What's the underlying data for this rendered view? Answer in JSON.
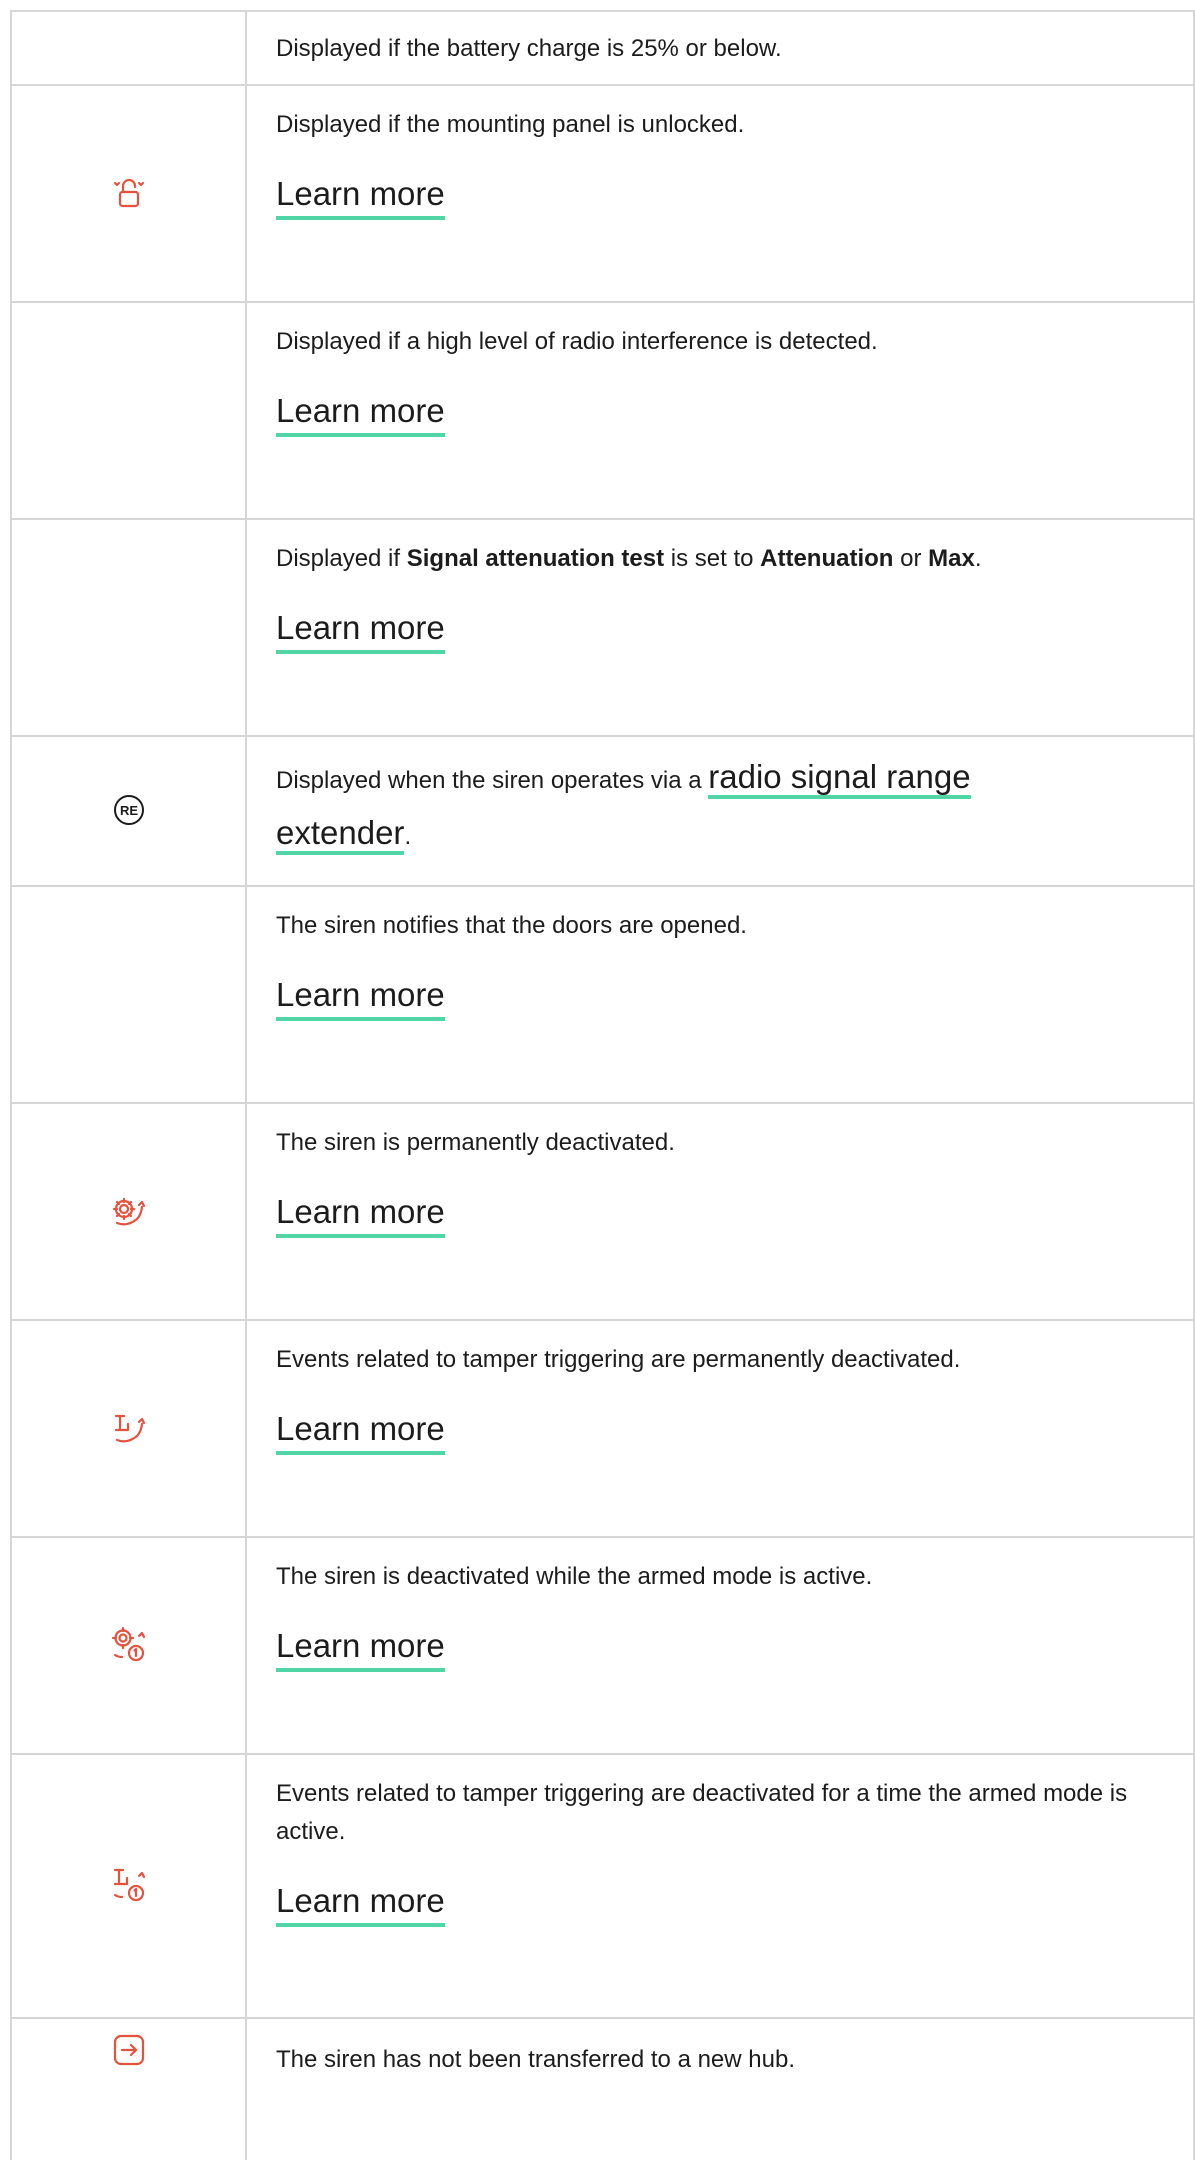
{
  "colors": {
    "icon_red": "#e5523d",
    "link_underline": "#4fd6a4",
    "grid": "#d6d6d6",
    "text": "#1c1c1c"
  },
  "learn_more": "Learn more",
  "rows": [
    {
      "icon": "",
      "text": "Displayed if the battery charge is 25% or below."
    },
    {
      "icon": "unlocked-padlock-icon",
      "text": "Displayed if the mounting panel is unlocked.",
      "link": "Learn more"
    },
    {
      "icon": "",
      "text": "Displayed if a high level of radio interference is detected.",
      "link": "Learn more"
    },
    {
      "icon": "",
      "text_parts": [
        "Displayed if ",
        "Signal attenuation test",
        " is set to ",
        "Attenuation",
        " or ",
        "Max",
        "."
      ],
      "link": "Learn more"
    },
    {
      "icon": "range-extender-re-icon",
      "text_before": "Displayed when the siren operates via a ",
      "inline_link": "radio signal range extender",
      "text_after": "."
    },
    {
      "icon": "",
      "text": "The siren notifies that the doors are opened.",
      "link": "Learn more"
    },
    {
      "icon": "gear-deactivated-icon",
      "text": "The siren is permanently deactivated.",
      "link": "Learn more"
    },
    {
      "icon": "tamper-deactivated-icon",
      "text": "Events related to tamper triggering are permanently deactivated.",
      "link": "Learn more"
    },
    {
      "icon": "gear-deactivated-armed-icon",
      "text": "The siren is deactivated while the armed mode is active.",
      "link": "Learn more"
    },
    {
      "icon": "tamper-deactivated-armed-icon",
      "text": "Events related to tamper triggering are deactivated for a time the armed mode is active.",
      "link": "Learn more"
    },
    {
      "icon": "transfer-arrow-icon",
      "text": "The siren has not been transferred to a new hub."
    }
  ]
}
